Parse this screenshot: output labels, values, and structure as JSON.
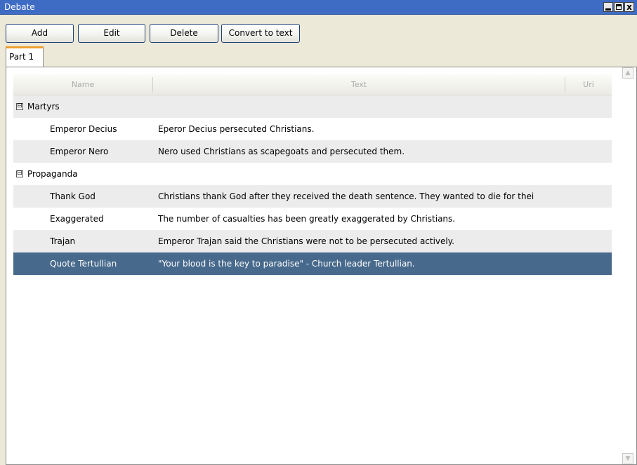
{
  "window": {
    "title": "Debate",
    "controls": {
      "minimize": "minimize-icon",
      "maximize": "maximize-icon",
      "close": "close-icon",
      "close_glyph": "x"
    }
  },
  "toolbar": {
    "add_label": "Add",
    "edit_label": "Edit",
    "delete_label": "Delete",
    "convert_label": "Convert to text"
  },
  "tabs": [
    {
      "label": "Part 1"
    }
  ],
  "grid": {
    "columns": [
      "Name",
      "Text",
      "Uri"
    ],
    "groups": [
      {
        "name": "Martyrs",
        "toggle": "⊟",
        "rows": [
          {
            "name": "Emperor Decius",
            "text": "Eperor Decius persecuted Christians."
          },
          {
            "name": "Emperor Nero",
            "text": "Nero used Christians as scapegoats and persecuted them."
          }
        ]
      },
      {
        "name": "Propaganda",
        "toggle": "⊟",
        "rows": [
          {
            "name": "Thank God",
            "text": "Christians thank God after they received the death sentence. They wanted to die for thei"
          },
          {
            "name": "Exaggerated",
            "text": "The number of casualties has been greatly exaggerated by Christians."
          },
          {
            "name": "Trajan",
            "text": "Emperor Trajan said the Christians were not to be persecuted actively."
          },
          {
            "name": "Quote Tertullian",
            "text": "\"Your blood is the key to paradise\" - Church leader Tertullian."
          }
        ]
      }
    ],
    "selected_row": "Quote Tertullian"
  },
  "scrollbar": {
    "up_icon": "scroll-up-arrow-icon",
    "down_icon": "scroll-down-arrow-icon"
  },
  "colors": {
    "titlebar": "#3e6bc4",
    "selection": "#47698c",
    "tab_accent": "#f0a030",
    "window_bg": "#ece9d8"
  }
}
